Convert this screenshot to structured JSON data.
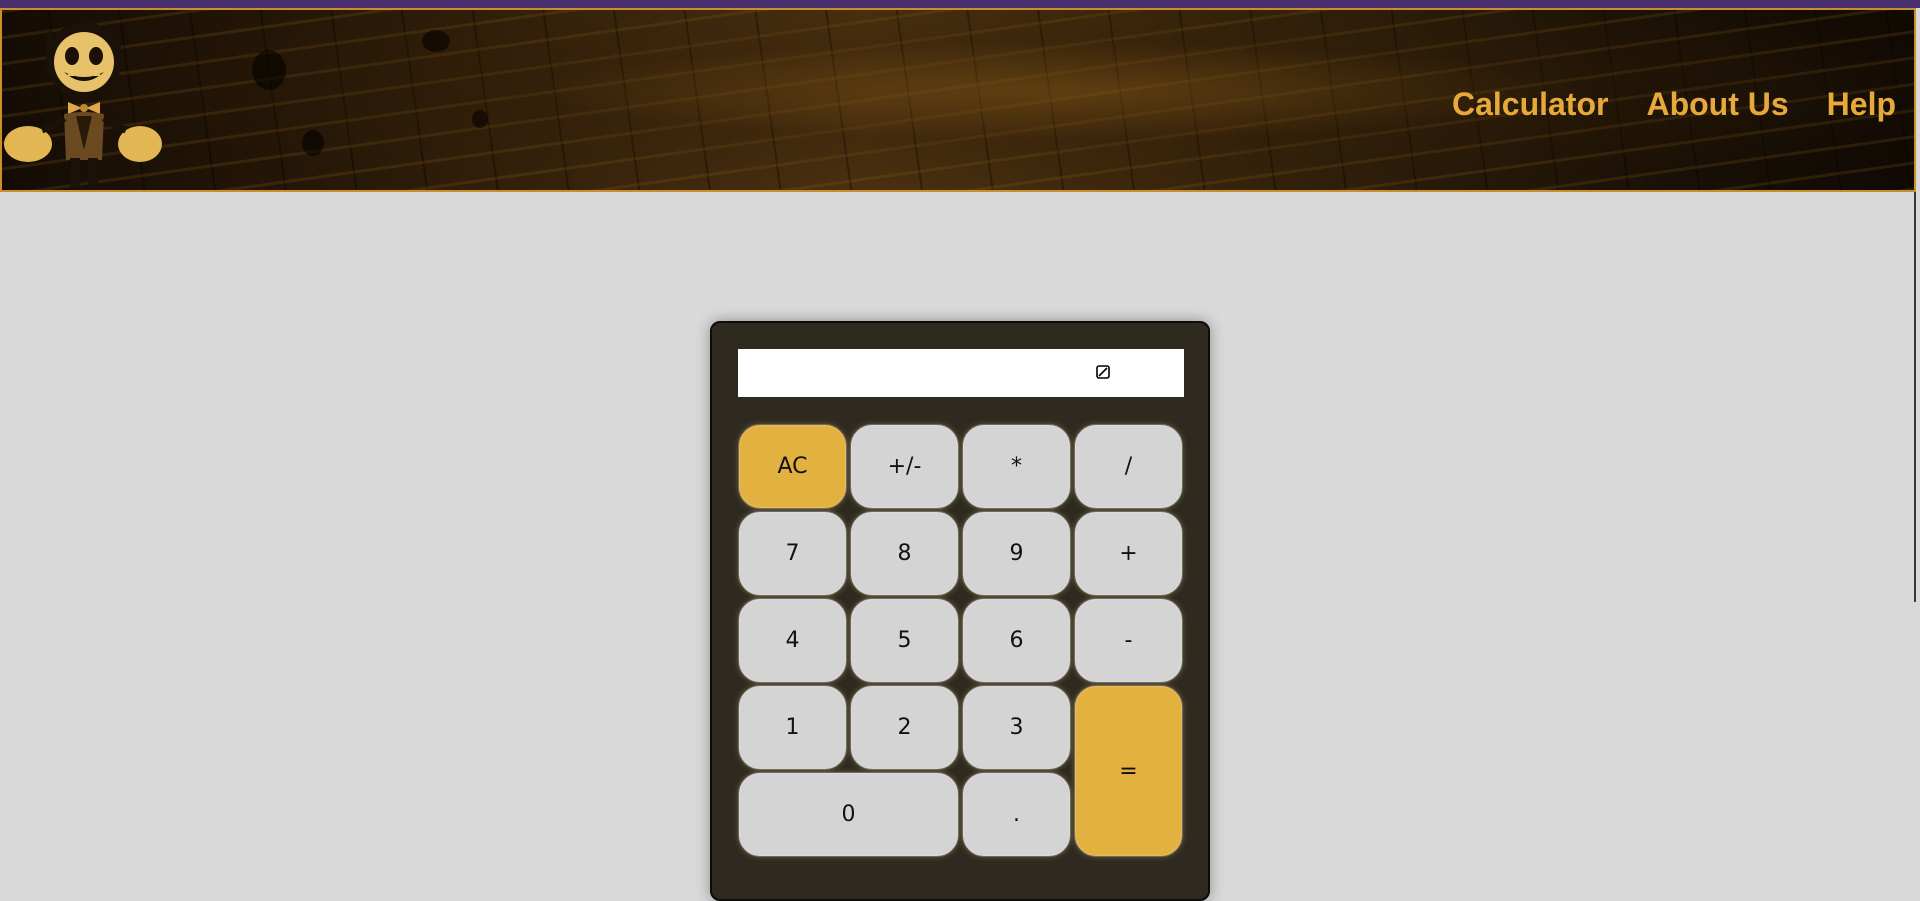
{
  "header": {
    "logo_icon": "bendy-character-logo",
    "nav": [
      {
        "label": "Calculator"
      },
      {
        "label": "About Us"
      },
      {
        "label": "Help"
      }
    ],
    "accent_color": "#e7aa3a",
    "border_color": "#c98f2a"
  },
  "calculator": {
    "display_value": "",
    "clear_icon": "clear-input-icon",
    "keys": {
      "ac": "AC",
      "negate": "+/-",
      "multiply": "*",
      "divide": "/",
      "seven": "7",
      "eight": "8",
      "nine": "9",
      "plus": "+",
      "four": "4",
      "five": "5",
      "six": "6",
      "minus": "-",
      "one": "1",
      "two": "2",
      "three": "3",
      "equals": "=",
      "zero": "0",
      "decimal": "."
    },
    "key_color": "#d4d4d4",
    "accent_key_color": "#e3b13f",
    "body_color": "#2f2a1f"
  }
}
